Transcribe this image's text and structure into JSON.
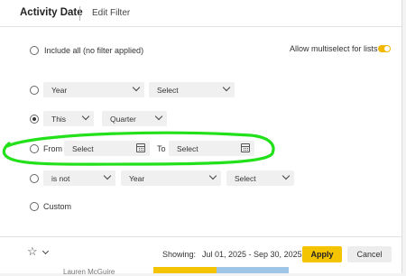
{
  "header": {
    "title": "Activity Date",
    "edit_filter": "Edit Filter"
  },
  "options": {
    "include_all": "Include all (no filter applied)",
    "multiselect_label": "Allow multiselect for lists",
    "row_year": {
      "unit": "Year",
      "value": "Select"
    },
    "row_this": {
      "this": "This",
      "unit": "Quarter"
    },
    "row_range": {
      "from": "From",
      "from_value": "Select",
      "to": "To",
      "to_value": "Select"
    },
    "row_not": {
      "op": "is not",
      "unit": "Year",
      "value": "Select"
    },
    "custom": "Custom"
  },
  "footer": {
    "showing_label": "Showing:",
    "showing_value": "Jul 01, 2025 - Sep 30, 2025",
    "apply": "Apply",
    "cancel": "Cancel",
    "background_fragment": "Lauren McGuire"
  },
  "colors": {
    "accent": "#f5c400",
    "toggle": "#f2b800",
    "highlight": "#22e01a"
  }
}
